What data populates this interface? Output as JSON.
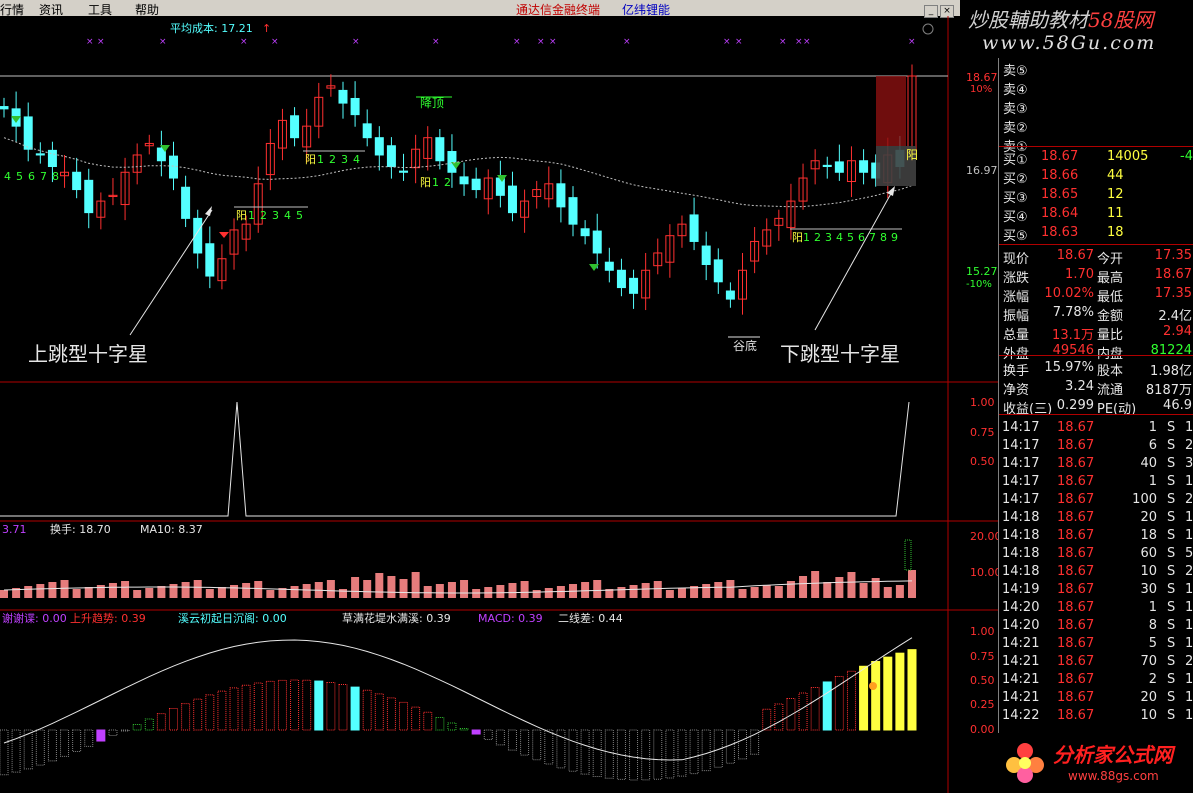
{
  "menu": {
    "items": [
      "行情",
      "资讯",
      "工具",
      "帮助"
    ],
    "title_red": "通达信金融终端",
    "title_blue": "亿纬锂能"
  },
  "brand_top": {
    "line1a": "炒股輔助教材",
    "line1b": "58股网",
    "line2": "www.58Gu.com"
  },
  "brand_bottom": {
    "line1": "分析家公式网",
    "line2": "www.88gs.com"
  },
  "main": {
    "header_label": "平均成本: 17.21",
    "price_axis": [
      "18.67",
      "10%",
      "16.97",
      "15.27",
      "-10%"
    ],
    "annotations": {
      "top_label": "降顶",
      "bottom_label": "谷底",
      "left_arrow_text": "上跳型十字星",
      "right_arrow_text": "下跳型十字星",
      "yang1": "阳",
      "yang_last": "阳"
    },
    "seq_a": [
      "4",
      "5",
      "6",
      "7",
      "8"
    ],
    "seq_b": [
      "阳",
      "1",
      "2",
      "3",
      "4",
      "5"
    ],
    "seq_c": [
      "阳",
      "1",
      "2",
      "3",
      "4"
    ],
    "seq_d": [
      "阳",
      "1",
      "2"
    ],
    "seq_e": [
      "阳",
      "1",
      "2",
      "3",
      "4",
      "5",
      "6",
      "7",
      "8",
      "9"
    ]
  },
  "signal": {
    "axis": [
      "1.00",
      "0.75",
      "0.50"
    ]
  },
  "volume": {
    "header": [
      "3.71",
      "换手: 18.70",
      "MA10: 8.37"
    ],
    "axis": [
      "20.00",
      "10.00"
    ]
  },
  "osc": {
    "header": [
      "谢谢谍: 0.00",
      "上升趋势: 0.39",
      "溪云初起日沉阁: 0.00",
      "草满花堤水满溪: 0.39",
      "MACD: 0.39",
      "二线差: 0.44"
    ],
    "axis": [
      "1.00",
      "0.75",
      "0.50",
      "0.25",
      "0.00"
    ]
  },
  "orderbook": {
    "sells": [
      "卖⑤",
      "卖④",
      "卖③",
      "卖②",
      "卖①"
    ],
    "buys": [
      {
        "label": "买①",
        "price": "18.67",
        "vol": "14005",
        "chg": "-4"
      },
      {
        "label": "买②",
        "price": "18.66",
        "vol": "44",
        "chg": ""
      },
      {
        "label": "买③",
        "price": "18.65",
        "vol": "12",
        "chg": ""
      },
      {
        "label": "买④",
        "price": "18.64",
        "vol": "11",
        "chg": ""
      },
      {
        "label": "买⑤",
        "price": "18.63",
        "vol": "18",
        "chg": ""
      }
    ]
  },
  "quote": [
    {
      "l1": "现价",
      "v1": "18.67",
      "l2": "今开",
      "v2": "17.35"
    },
    {
      "l1": "涨跌",
      "v1": "1.70",
      "l2": "最高",
      "v2": "18.67"
    },
    {
      "l1": "涨幅",
      "v1": "10.02%",
      "l2": "最低",
      "v2": "17.35"
    },
    {
      "l1": "振幅",
      "v1": "7.78%",
      "l2": "金额",
      "v2": "2.4亿"
    },
    {
      "l1": "总量",
      "v1": "13.1万",
      "l2": "量比",
      "v2": "2.94"
    },
    {
      "l1": "外盘",
      "v1": "49546",
      "l2": "内盘",
      "v2": "81224"
    },
    {
      "l1": "换手",
      "v1": "15.97%",
      "l2": "股本",
      "v2": "1.98亿"
    },
    {
      "l1": "净资",
      "v1": "3.24",
      "l2": "流通",
      "v2": "8187万"
    },
    {
      "l1": "收益(三)",
      "v1": "0.299",
      "l2": "PE(动)",
      "v2": "46.9"
    }
  ],
  "ticks": [
    {
      "t": "14:17",
      "p": "18.67",
      "v": "1",
      "s": "S",
      "n": "1"
    },
    {
      "t": "14:17",
      "p": "18.67",
      "v": "6",
      "s": "S",
      "n": "2"
    },
    {
      "t": "14:17",
      "p": "18.67",
      "v": "40",
      "s": "S",
      "n": "3"
    },
    {
      "t": "14:17",
      "p": "18.67",
      "v": "1",
      "s": "S",
      "n": "1"
    },
    {
      "t": "14:17",
      "p": "18.67",
      "v": "100",
      "s": "S",
      "n": "2"
    },
    {
      "t": "14:18",
      "p": "18.67",
      "v": "20",
      "s": "S",
      "n": "1"
    },
    {
      "t": "14:18",
      "p": "18.67",
      "v": "18",
      "s": "S",
      "n": "1"
    },
    {
      "t": "14:18",
      "p": "18.67",
      "v": "60",
      "s": "S",
      "n": "5"
    },
    {
      "t": "14:18",
      "p": "18.67",
      "v": "10",
      "s": "S",
      "n": "2"
    },
    {
      "t": "14:19",
      "p": "18.67",
      "v": "30",
      "s": "S",
      "n": "1"
    },
    {
      "t": "14:20",
      "p": "18.67",
      "v": "1",
      "s": "S",
      "n": "1"
    },
    {
      "t": "14:20",
      "p": "18.67",
      "v": "8",
      "s": "S",
      "n": "1"
    },
    {
      "t": "14:21",
      "p": "18.67",
      "v": "5",
      "s": "S",
      "n": "1"
    },
    {
      "t": "14:21",
      "p": "18.67",
      "v": "70",
      "s": "S",
      "n": "2"
    },
    {
      "t": "14:21",
      "p": "18.67",
      "v": "2",
      "s": "S",
      "n": "1"
    },
    {
      "t": "14:21",
      "p": "18.67",
      "v": "20",
      "s": "S",
      "n": "1"
    },
    {
      "t": "14:22",
      "p": "18.67",
      "v": "10",
      "s": "S",
      "n": "1"
    }
  ],
  "colors": {
    "up": "#ff3030",
    "down": "#54ffff",
    "menu": "#d4d0c8",
    "magenta": "#c040ff",
    "yellow": "#ffff40"
  }
}
